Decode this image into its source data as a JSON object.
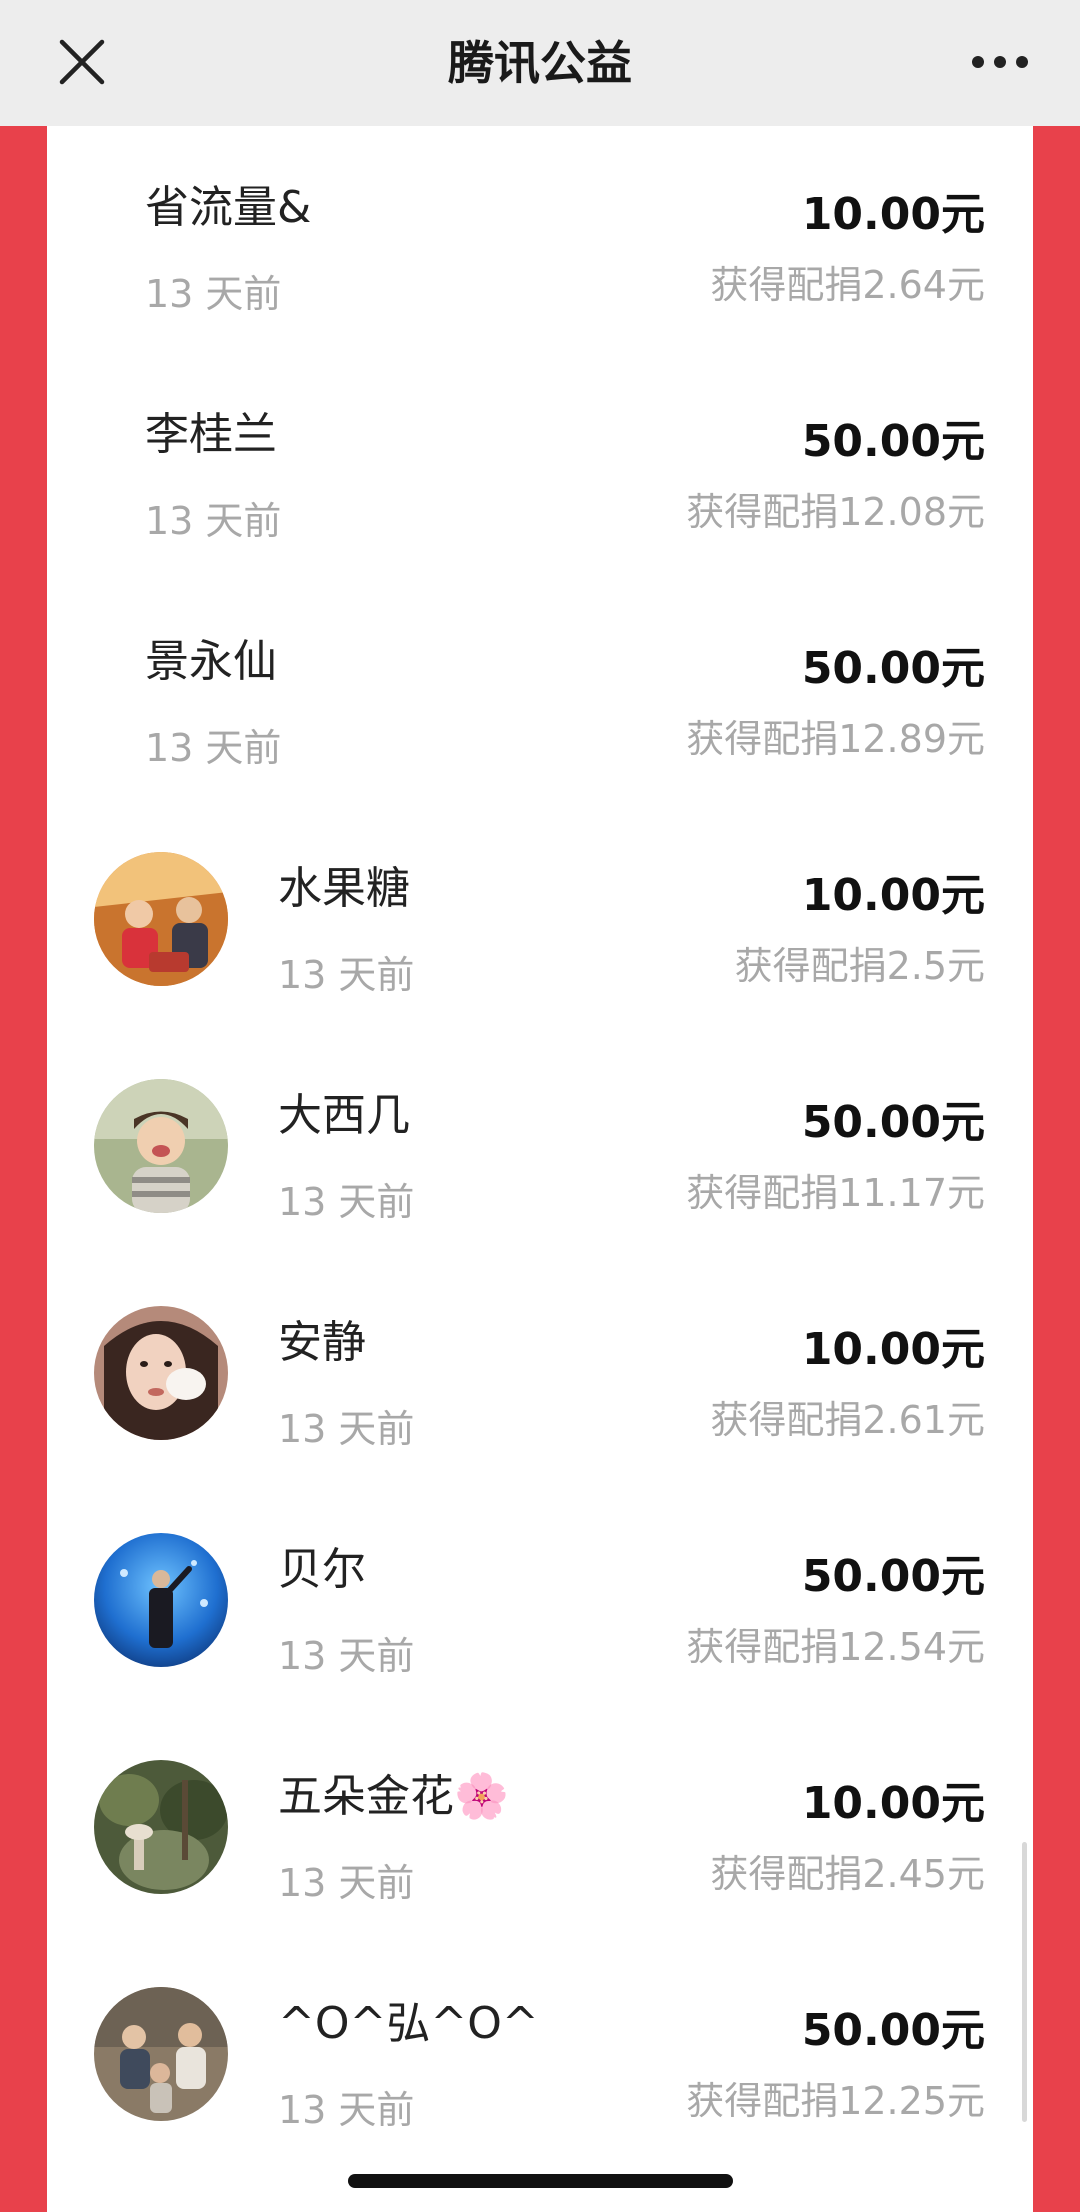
{
  "header": {
    "title": "腾讯公益",
    "close_icon": "close-icon",
    "more_icon": "more-icon"
  },
  "colors": {
    "background_red": "#e8414b",
    "topbar": "#ededed",
    "secondary_text": "#a8a8a8"
  },
  "donations": [
    {
      "name": "省流量&",
      "time": "13 天前",
      "amount": "10.00元",
      "match": "获得配捐2.64元",
      "avatar": ""
    },
    {
      "name": "李桂兰",
      "time": "13 天前",
      "amount": "50.00元",
      "match": "获得配捐12.08元",
      "avatar": ""
    },
    {
      "name": "景永仙",
      "time": "13 天前",
      "amount": "50.00元",
      "match": "获得配捐12.89元",
      "avatar": ""
    },
    {
      "name": "水果糖",
      "time": "13 天前",
      "amount": "10.00元",
      "match": "获得配捐2.5元",
      "avatar": "avatar-family-photo"
    },
    {
      "name": "大西几",
      "time": "13 天前",
      "amount": "50.00元",
      "match": "获得配捐11.17元",
      "avatar": "avatar-child-photo"
    },
    {
      "name": "安静",
      "time": "13 天前",
      "amount": "10.00元",
      "match": "获得配捐2.61元",
      "avatar": "avatar-woman-photo"
    },
    {
      "name": "贝尔",
      "time": "13 天前",
      "amount": "50.00元",
      "match": "获得配捐12.54元",
      "avatar": "avatar-aquarium-photo"
    },
    {
      "name": "五朵金花🌸",
      "time": "13 天前",
      "amount": "10.00元",
      "match": "获得配捐2.45元",
      "avatar": "avatar-garden-photo"
    },
    {
      "name": "^O^弘^O^",
      "time": "13 天前",
      "amount": "50.00元",
      "match": "获得配捐12.25元",
      "avatar": "avatar-kids-photo"
    }
  ]
}
